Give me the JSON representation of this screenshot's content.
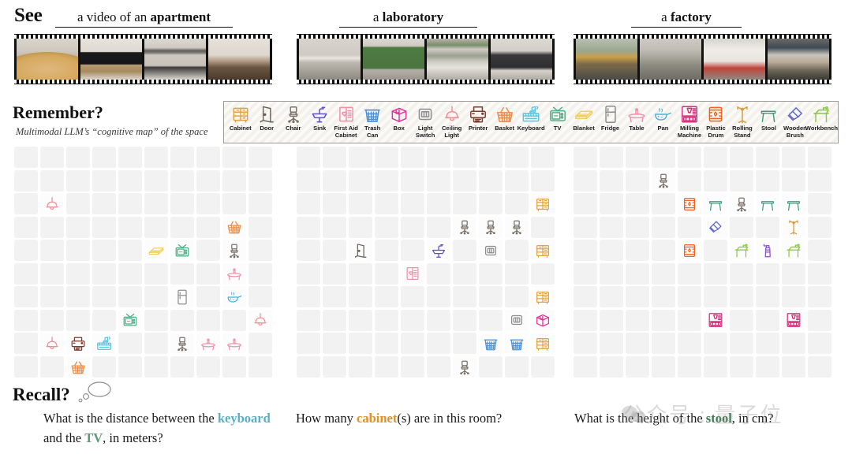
{
  "headings": {
    "see": "See",
    "remember": "Remember?",
    "remember_sub": "Multimodal LLM’s “cognitive map” of the space",
    "recall": "Recall?"
  },
  "scenes": [
    {
      "id": "apartment",
      "title_prefix": "a video of an ",
      "title_bold": "apartment"
    },
    {
      "id": "laboratory",
      "title_prefix": "a ",
      "title_bold": "laboratory"
    },
    {
      "id": "factory",
      "title_prefix": "a ",
      "title_bold": "factory"
    }
  ],
  "legend": [
    {
      "name": "Cabinet",
      "icon": "cabinet-icon",
      "color": "#e2a33e"
    },
    {
      "name": "Door",
      "icon": "door-icon",
      "color": "#6b6356"
    },
    {
      "name": "Chair",
      "icon": "chair-icon",
      "color": "#7a7068"
    },
    {
      "name": "Sink",
      "icon": "sink-icon",
      "color": "#5b52c4"
    },
    {
      "name": "First Aid\nCabinet",
      "icon": "first-aid-cabinet-icon",
      "color": "#ef8fa6"
    },
    {
      "name": "Trash\nCan",
      "icon": "trash-can-icon",
      "color": "#4a90d9"
    },
    {
      "name": "Box",
      "icon": "box-icon",
      "color": "#e0309a"
    },
    {
      "name": "Light\nSwitch",
      "icon": "light-switch-icon",
      "color": "#8c8c8c"
    },
    {
      "name": "Ceiling\nLight",
      "icon": "ceiling-light-icon",
      "color": "#ee8f96"
    },
    {
      "name": "Printer",
      "icon": "printer-icon",
      "color": "#7b3b2e"
    },
    {
      "name": "Basket",
      "icon": "basket-icon",
      "color": "#f08a43"
    },
    {
      "name": "Keyboard",
      "icon": "keyboard-icon",
      "color": "#5bc5dd"
    },
    {
      "name": "TV",
      "icon": "tv-icon",
      "color": "#4fae86"
    },
    {
      "name": "Blanket",
      "icon": "blanket-icon",
      "color": "#f2cf5c"
    },
    {
      "name": "Fridge",
      "icon": "fridge-icon",
      "color": "#8d8d8d"
    },
    {
      "name": "Table",
      "icon": "table-icon",
      "color": "#f291ae"
    },
    {
      "name": "Pan",
      "icon": "pan-icon",
      "color": "#4ab4d6"
    },
    {
      "name": "Milling\nMachine",
      "icon": "milling-machine-icon",
      "color": "#d62a7a"
    },
    {
      "name": "Plastic\nDrum",
      "icon": "plastic-drum-icon",
      "color": "#f4601f"
    },
    {
      "name": "Rolling\nStand",
      "icon": "rolling-stand-icon",
      "color": "#d79b3c"
    },
    {
      "name": "Stool",
      "icon": "stool-icon",
      "color": "#3f9a7e"
    },
    {
      "name": "Wooden\nBrush",
      "icon": "wooden-brush-icon",
      "color": "#5b66cc"
    },
    {
      "name": "Workbench",
      "icon": "workbench-icon",
      "color": "#8ac93a"
    }
  ],
  "maps": [
    {
      "id": "apartment-cognitive-map",
      "cols": 10,
      "rows": 10,
      "objects": [
        {
          "icon": "ceiling-light-icon",
          "col": 1,
          "row": 2
        },
        {
          "icon": "basket-icon",
          "col": 8,
          "row": 3
        },
        {
          "icon": "blanket-icon",
          "col": 5,
          "row": 4
        },
        {
          "icon": "tv-icon",
          "col": 6,
          "row": 4
        },
        {
          "icon": "chair-icon",
          "col": 8,
          "row": 4
        },
        {
          "icon": "table-icon",
          "col": 8,
          "row": 5
        },
        {
          "icon": "fridge-icon",
          "col": 6,
          "row": 6
        },
        {
          "icon": "pan-icon",
          "col": 8,
          "row": 6
        },
        {
          "icon": "tv-icon",
          "col": 4,
          "row": 7
        },
        {
          "icon": "ceiling-light-icon",
          "col": 9,
          "row": 7
        },
        {
          "icon": "ceiling-light-icon",
          "col": 1,
          "row": 8
        },
        {
          "icon": "printer-icon",
          "col": 2,
          "row": 8
        },
        {
          "icon": "keyboard-icon",
          "col": 3,
          "row": 8
        },
        {
          "icon": "chair-icon",
          "col": 6,
          "row": 8
        },
        {
          "icon": "table-icon",
          "col": 7,
          "row": 8
        },
        {
          "icon": "table-icon",
          "col": 8,
          "row": 8
        },
        {
          "icon": "basket-icon",
          "col": 2,
          "row": 9
        }
      ]
    },
    {
      "id": "laboratory-cognitive-map",
      "cols": 10,
      "rows": 10,
      "objects": [
        {
          "icon": "cabinet-icon",
          "col": 9,
          "row": 2
        },
        {
          "icon": "chair-icon",
          "col": 6,
          "row": 3
        },
        {
          "icon": "chair-icon",
          "col": 7,
          "row": 3
        },
        {
          "icon": "chair-icon",
          "col": 8,
          "row": 3
        },
        {
          "icon": "door-icon",
          "col": 2,
          "row": 4
        },
        {
          "icon": "sink-icon",
          "col": 5,
          "row": 4
        },
        {
          "icon": "light-switch-icon",
          "col": 7,
          "row": 4
        },
        {
          "icon": "cabinet-icon",
          "col": 9,
          "row": 4
        },
        {
          "icon": "first-aid-cabinet-icon",
          "col": 4,
          "row": 5
        },
        {
          "icon": "cabinet-icon",
          "col": 9,
          "row": 6
        },
        {
          "icon": "light-switch-icon",
          "col": 8,
          "row": 7
        },
        {
          "icon": "box-icon",
          "col": 9,
          "row": 7
        },
        {
          "icon": "trash-can-icon",
          "col": 7,
          "row": 8
        },
        {
          "icon": "trash-can-icon",
          "col": 8,
          "row": 8
        },
        {
          "icon": "cabinet-icon",
          "col": 9,
          "row": 8
        },
        {
          "icon": "chair-icon",
          "col": 6,
          "row": 9
        }
      ]
    },
    {
      "id": "factory-cognitive-map",
      "cols": 10,
      "rows": 10,
      "objects": [
        {
          "icon": "chair-icon",
          "col": 3,
          "row": 1
        },
        {
          "icon": "plastic-drum-icon",
          "col": 4,
          "row": 2
        },
        {
          "icon": "stool-icon",
          "col": 5,
          "row": 2
        },
        {
          "icon": "chair-icon",
          "col": 6,
          "row": 2
        },
        {
          "icon": "stool-icon",
          "col": 7,
          "row": 2
        },
        {
          "icon": "stool-icon",
          "col": 8,
          "row": 2
        },
        {
          "icon": "wooden-brush-icon",
          "col": 5,
          "row": 3
        },
        {
          "icon": "rolling-stand-icon",
          "col": 8,
          "row": 3
        },
        {
          "icon": "plastic-drum-icon",
          "col": 4,
          "row": 4
        },
        {
          "icon": "workbench-icon",
          "col": 6,
          "row": 4
        },
        {
          "icon": "spray-icon",
          "col": 7,
          "row": 4
        },
        {
          "icon": "workbench-icon",
          "col": 8,
          "row": 4
        },
        {
          "icon": "milling-machine-icon",
          "col": 5,
          "row": 7
        },
        {
          "icon": "milling-machine-icon",
          "col": 8,
          "row": 7
        }
      ]
    }
  ],
  "questions": [
    {
      "id": "distance-question",
      "parts": [
        {
          "t": "What is the distance between the ",
          "k": ""
        },
        {
          "t": "keyboard",
          "k": "keyboard"
        },
        {
          "t": " and the ",
          "k": ""
        },
        {
          "t": "TV",
          "k": "tv"
        },
        {
          "t": ", in meters?",
          "k": ""
        }
      ]
    },
    {
      "id": "count-question",
      "parts": [
        {
          "t": "How many ",
          "k": ""
        },
        {
          "t": "cabinet",
          "k": "cabinet"
        },
        {
          "t": "(s) are in this room?",
          "k": ""
        }
      ]
    },
    {
      "id": "height-question",
      "parts": [
        {
          "t": "What is the height of the ",
          "k": ""
        },
        {
          "t": "stool",
          "k": "stool"
        },
        {
          "t": ", in cm?",
          "k": ""
        }
      ]
    }
  ],
  "watermark": {
    "text": "公众号 : 量子位"
  }
}
